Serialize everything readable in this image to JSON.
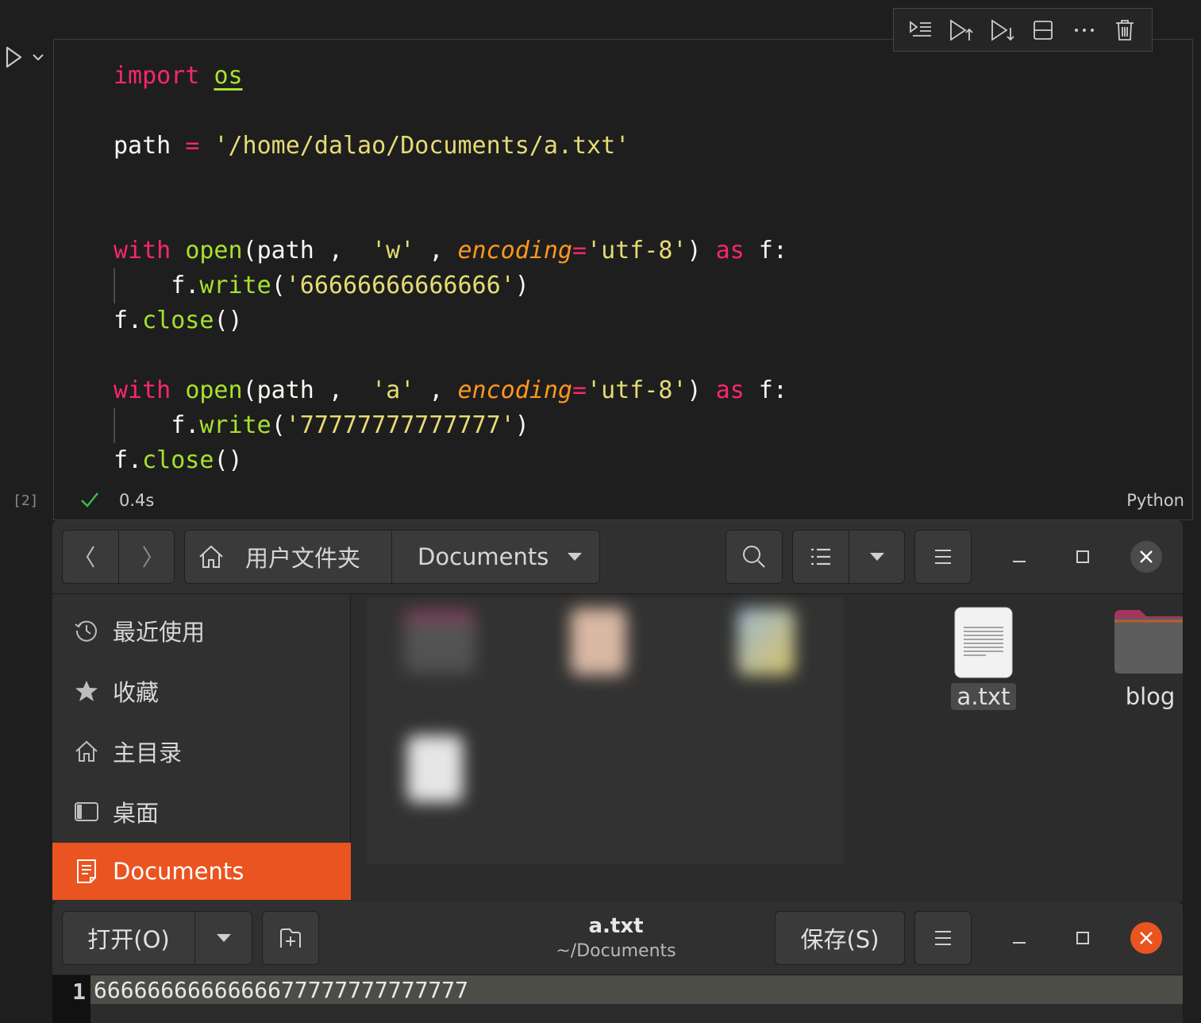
{
  "notebook": {
    "execution_count": "[2]",
    "duration": "0.4s",
    "language": "Python",
    "toolbar": [
      "execute-above-icon",
      "run-up-icon",
      "run-down-icon",
      "split-cell-icon",
      "more-icon",
      "delete-icon"
    ],
    "code": {
      "l1": {
        "t1": "import",
        "t2": " ",
        "t3": "os"
      },
      "l2": {
        "t1": "path ",
        "t2": "=",
        "t3": " ",
        "t4": "'/home/dalao/Documents/a.txt'"
      },
      "l3": {
        "t1": "with",
        "t2": " ",
        "t3": "open",
        "t4": "(path ,  ",
        "t5": "'w'",
        "t6": " , ",
        "t7": "encoding",
        "t8": "=",
        "t9": "'utf-8'",
        "t10": ") ",
        "t11": "as",
        "t12": " f:"
      },
      "l4": {
        "t1": "    f.",
        "t2": "write",
        "t3": "(",
        "t4": "'66666666666666'",
        "t5": ")"
      },
      "l5": {
        "t1": "f.",
        "t2": "close",
        "t3": "()"
      },
      "l6": {
        "t1": "with",
        "t2": " ",
        "t3": "open",
        "t4": "(path ,  ",
        "t5": "'a'",
        "t6": " , ",
        "t7": "encoding",
        "t8": "=",
        "t9": "'utf-8'",
        "t10": ") ",
        "t11": "as",
        "t12": " f:"
      },
      "l7": {
        "t1": "    f.",
        "t2": "write",
        "t3": "(",
        "t4": "'77777777777777'",
        "t5": ")"
      },
      "l8": {
        "t1": "f.",
        "t2": "close",
        "t3": "()"
      }
    },
    "colors": {
      "keyword": "#f92672",
      "function": "#a6e22e",
      "string": "#e6db74",
      "param": "#fd971f",
      "success": "#3fb950"
    }
  },
  "files": {
    "breadcrumb": {
      "home": "用户文件夹",
      "current": "Documents"
    },
    "sidebar": [
      {
        "label": "最近使用",
        "icon": "clock-icon"
      },
      {
        "label": "收藏",
        "icon": "star-icon"
      },
      {
        "label": "主目录",
        "icon": "home-icon"
      },
      {
        "label": "桌面",
        "icon": "desktop-icon"
      },
      {
        "label": "Documents",
        "icon": "document-icon"
      }
    ],
    "items": [
      {
        "name": "a.txt",
        "icon": "text-file-icon"
      },
      {
        "name": "blog",
        "icon": "folder-icon"
      }
    ],
    "accent": "#e95420"
  },
  "editor": {
    "title": "a.txt",
    "subtitle": "~/Documents",
    "open_label": "打开(O)",
    "save_label": "保存(S)",
    "line_number": "1",
    "line_text": "6666666666666677777777777777"
  }
}
